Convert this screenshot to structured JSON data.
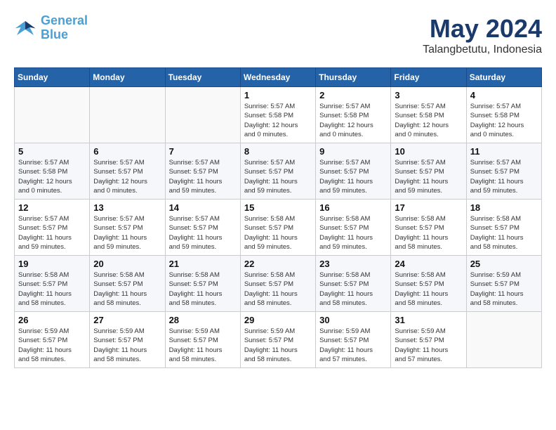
{
  "header": {
    "logo_line1": "General",
    "logo_line2": "Blue",
    "month": "May 2024",
    "location": "Talangbetutu, Indonesia"
  },
  "days_of_week": [
    "Sunday",
    "Monday",
    "Tuesday",
    "Wednesday",
    "Thursday",
    "Friday",
    "Saturday"
  ],
  "weeks": [
    [
      {
        "day": "",
        "text": ""
      },
      {
        "day": "",
        "text": ""
      },
      {
        "day": "",
        "text": ""
      },
      {
        "day": "1",
        "text": "Sunrise: 5:57 AM\nSunset: 5:58 PM\nDaylight: 12 hours\nand 0 minutes."
      },
      {
        "day": "2",
        "text": "Sunrise: 5:57 AM\nSunset: 5:58 PM\nDaylight: 12 hours\nand 0 minutes."
      },
      {
        "day": "3",
        "text": "Sunrise: 5:57 AM\nSunset: 5:58 PM\nDaylight: 12 hours\nand 0 minutes."
      },
      {
        "day": "4",
        "text": "Sunrise: 5:57 AM\nSunset: 5:58 PM\nDaylight: 12 hours\nand 0 minutes."
      }
    ],
    [
      {
        "day": "5",
        "text": "Sunrise: 5:57 AM\nSunset: 5:58 PM\nDaylight: 12 hours\nand 0 minutes."
      },
      {
        "day": "6",
        "text": "Sunrise: 5:57 AM\nSunset: 5:57 PM\nDaylight: 12 hours\nand 0 minutes."
      },
      {
        "day": "7",
        "text": "Sunrise: 5:57 AM\nSunset: 5:57 PM\nDaylight: 11 hours\nand 59 minutes."
      },
      {
        "day": "8",
        "text": "Sunrise: 5:57 AM\nSunset: 5:57 PM\nDaylight: 11 hours\nand 59 minutes."
      },
      {
        "day": "9",
        "text": "Sunrise: 5:57 AM\nSunset: 5:57 PM\nDaylight: 11 hours\nand 59 minutes."
      },
      {
        "day": "10",
        "text": "Sunrise: 5:57 AM\nSunset: 5:57 PM\nDaylight: 11 hours\nand 59 minutes."
      },
      {
        "day": "11",
        "text": "Sunrise: 5:57 AM\nSunset: 5:57 PM\nDaylight: 11 hours\nand 59 minutes."
      }
    ],
    [
      {
        "day": "12",
        "text": "Sunrise: 5:57 AM\nSunset: 5:57 PM\nDaylight: 11 hours\nand 59 minutes."
      },
      {
        "day": "13",
        "text": "Sunrise: 5:57 AM\nSunset: 5:57 PM\nDaylight: 11 hours\nand 59 minutes."
      },
      {
        "day": "14",
        "text": "Sunrise: 5:57 AM\nSunset: 5:57 PM\nDaylight: 11 hours\nand 59 minutes."
      },
      {
        "day": "15",
        "text": "Sunrise: 5:58 AM\nSunset: 5:57 PM\nDaylight: 11 hours\nand 59 minutes."
      },
      {
        "day": "16",
        "text": "Sunrise: 5:58 AM\nSunset: 5:57 PM\nDaylight: 11 hours\nand 59 minutes."
      },
      {
        "day": "17",
        "text": "Sunrise: 5:58 AM\nSunset: 5:57 PM\nDaylight: 11 hours\nand 58 minutes."
      },
      {
        "day": "18",
        "text": "Sunrise: 5:58 AM\nSunset: 5:57 PM\nDaylight: 11 hours\nand 58 minutes."
      }
    ],
    [
      {
        "day": "19",
        "text": "Sunrise: 5:58 AM\nSunset: 5:57 PM\nDaylight: 11 hours\nand 58 minutes."
      },
      {
        "day": "20",
        "text": "Sunrise: 5:58 AM\nSunset: 5:57 PM\nDaylight: 11 hours\nand 58 minutes."
      },
      {
        "day": "21",
        "text": "Sunrise: 5:58 AM\nSunset: 5:57 PM\nDaylight: 11 hours\nand 58 minutes."
      },
      {
        "day": "22",
        "text": "Sunrise: 5:58 AM\nSunset: 5:57 PM\nDaylight: 11 hours\nand 58 minutes."
      },
      {
        "day": "23",
        "text": "Sunrise: 5:58 AM\nSunset: 5:57 PM\nDaylight: 11 hours\nand 58 minutes."
      },
      {
        "day": "24",
        "text": "Sunrise: 5:58 AM\nSunset: 5:57 PM\nDaylight: 11 hours\nand 58 minutes."
      },
      {
        "day": "25",
        "text": "Sunrise: 5:59 AM\nSunset: 5:57 PM\nDaylight: 11 hours\nand 58 minutes."
      }
    ],
    [
      {
        "day": "26",
        "text": "Sunrise: 5:59 AM\nSunset: 5:57 PM\nDaylight: 11 hours\nand 58 minutes."
      },
      {
        "day": "27",
        "text": "Sunrise: 5:59 AM\nSunset: 5:57 PM\nDaylight: 11 hours\nand 58 minutes."
      },
      {
        "day": "28",
        "text": "Sunrise: 5:59 AM\nSunset: 5:57 PM\nDaylight: 11 hours\nand 58 minutes."
      },
      {
        "day": "29",
        "text": "Sunrise: 5:59 AM\nSunset: 5:57 PM\nDaylight: 11 hours\nand 58 minutes."
      },
      {
        "day": "30",
        "text": "Sunrise: 5:59 AM\nSunset: 5:57 PM\nDaylight: 11 hours\nand 57 minutes."
      },
      {
        "day": "31",
        "text": "Sunrise: 5:59 AM\nSunset: 5:57 PM\nDaylight: 11 hours\nand 57 minutes."
      },
      {
        "day": "",
        "text": ""
      }
    ]
  ]
}
